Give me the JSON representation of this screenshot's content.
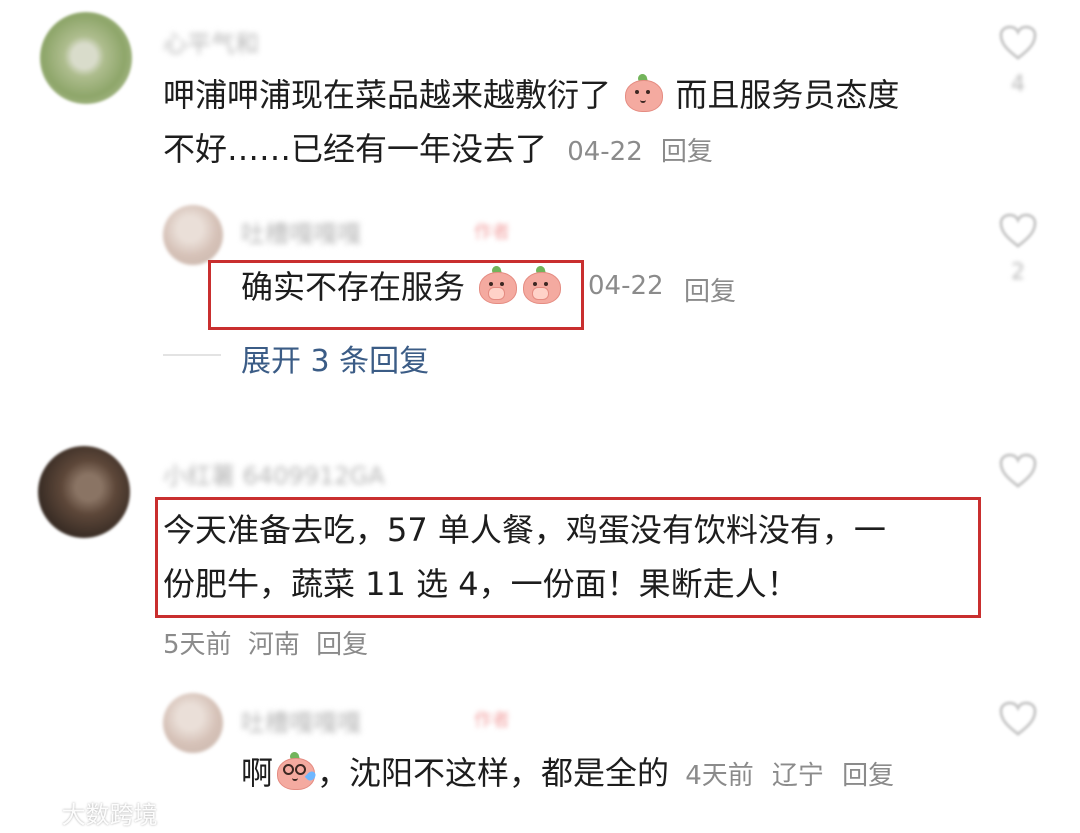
{
  "comments": [
    {
      "username": "心平气和",
      "text_line1_part1": "呷浦呷浦现在菜品越来越敷衍了",
      "text_line1_part2": "而且服务员态度",
      "text_line2": "不好……已经有一年没去了",
      "meta": "04-22",
      "reply": "回复",
      "likes": "4",
      "avatar_icon": "avatar-icon",
      "emoji_icon": "smile-emoji-icon",
      "replies": [
        {
          "username": "吐槽嘎嘎嘎",
          "tag": "作者",
          "text": "确实不存在服务",
          "meta": "04-22",
          "reply": "回复",
          "likes": "2",
          "emoji_icon": "covering-mouth-emoji-icon"
        }
      ],
      "expand_label": "展开 3 条回复"
    },
    {
      "username": "小红薯 6409912GA",
      "text_line1": "今天准备去吃，57 单人餐，鸡蛋没有饮料没有，一",
      "text_line2": "份肥牛，蔬菜 11 选 4，一份面！果断走人！",
      "time": "5天前",
      "location": "河南",
      "reply": "回复",
      "avatar_icon": "avatar-icon",
      "replies": [
        {
          "username": "吐槽嘎嘎嘎",
          "tag": "作者",
          "text_prefix": "啊",
          "text_suffix": "，沈阳不这样，都是全的",
          "time": "4天前",
          "location": "辽宁",
          "reply": "回复",
          "emoji_icon": "nervous-glasses-emoji-icon"
        }
      ]
    }
  ],
  "highlight_color": "#c92f2f",
  "link_color": "#3b5c86",
  "watermark": {
    "text": "大数跨境",
    "icon": "brand-logo-icon"
  }
}
